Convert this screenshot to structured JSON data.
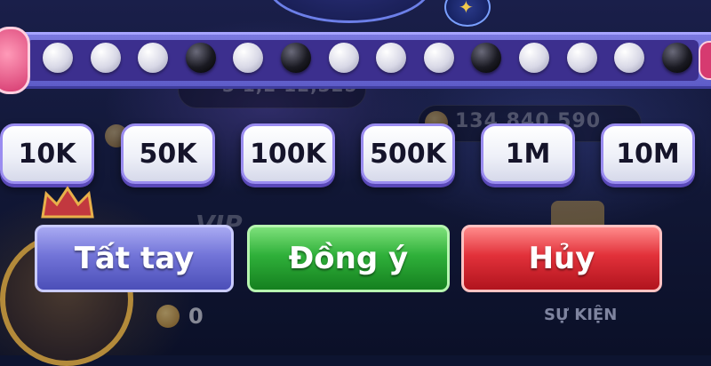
{
  "bead_road": {
    "beads": [
      "white",
      "white",
      "white",
      "black",
      "white",
      "black",
      "white",
      "white",
      "white",
      "black",
      "white",
      "white",
      "white",
      "black"
    ]
  },
  "background": {
    "faint_amount_1": "3 1,2 12,325",
    "faint_amount_2": "134 840 590",
    "vip_label": "VIP",
    "balance_value": "0",
    "event_label": "SỰ KIỆN"
  },
  "chips": [
    {
      "label": "10K"
    },
    {
      "label": "50K"
    },
    {
      "label": "100K"
    },
    {
      "label": "500K"
    },
    {
      "label": "1M"
    },
    {
      "label": "10M"
    }
  ],
  "actions": {
    "all_in_label": "Tất tay",
    "confirm_label": "Đồng ý",
    "cancel_label": "Hủy"
  },
  "colors": {
    "all_in": "#6f72d6",
    "confirm": "#2fb03a",
    "cancel": "#e2313a",
    "strip": "#6b69d6"
  }
}
